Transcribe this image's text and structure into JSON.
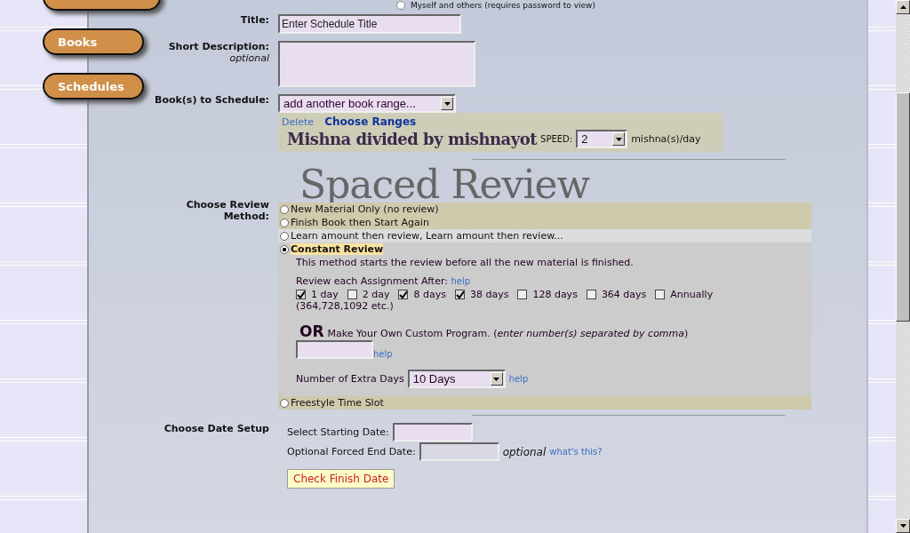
{
  "top_option": {
    "label": "Myself and others (requires password to view)",
    "selected": false
  },
  "nav": [
    {
      "label": "Books"
    },
    {
      "label": "Schedules"
    }
  ],
  "title_field": {
    "label": "Title:",
    "value": "Enter Schedule Title"
  },
  "description": {
    "label": "Short Description:",
    "hint": "optional"
  },
  "books": {
    "label": "Book(s) to Schedule:",
    "select": "add another book range...",
    "delete": "Delete",
    "choose": "Choose Ranges",
    "book_name": "Mishna divided by mishnayot",
    "speed_label": "SPEED:",
    "speed": "2",
    "unit": "mishna(s)/day"
  },
  "overlay_title": "Spaced Review",
  "review": {
    "label": "Choose Review Method:",
    "methods": [
      {
        "label": "New Material Only (no review)",
        "selected": false,
        "hover": false
      },
      {
        "label": "Finish Book then Start Again",
        "selected": false,
        "hover": false
      },
      {
        "label": "Learn amount then review, Learn amount then review...",
        "selected": false,
        "hover": true
      },
      {
        "label": "Constant Review",
        "selected": true,
        "hover": false
      },
      {
        "label": "Freestyle Time Slot",
        "selected": false,
        "hover": false
      }
    ],
    "details": {
      "description": "This method starts the review before all the new material is finished.",
      "after_label": "Review each Assignment After:",
      "help": "help",
      "intervals": [
        {
          "label": "1 day",
          "checked": true
        },
        {
          "label": "2 day",
          "checked": false
        },
        {
          "label": "8 days",
          "checked": true
        },
        {
          "label": "38 days",
          "checked": true
        },
        {
          "label": "128 days",
          "checked": false
        },
        {
          "label": "364 days",
          "checked": false
        },
        {
          "label": "Annually",
          "checked": false
        }
      ],
      "annual_note": "(364,728,1092 etc.)",
      "or": "OR",
      "custom": "Make Your Own Custom Program. (*enter number(s) separated by comma*)",
      "custom_help": "help",
      "extra_label": "Number of Extra Days",
      "extra_value": "10 Days",
      "extra_help": "help"
    }
  },
  "dates": {
    "label": "Choose Date Setup",
    "start_label": "Select Starting Date:",
    "end_label": "Optional Forced End Date:",
    "optional": "optional",
    "whats_this": "what's this?",
    "check_button": "Check Finish Date"
  }
}
